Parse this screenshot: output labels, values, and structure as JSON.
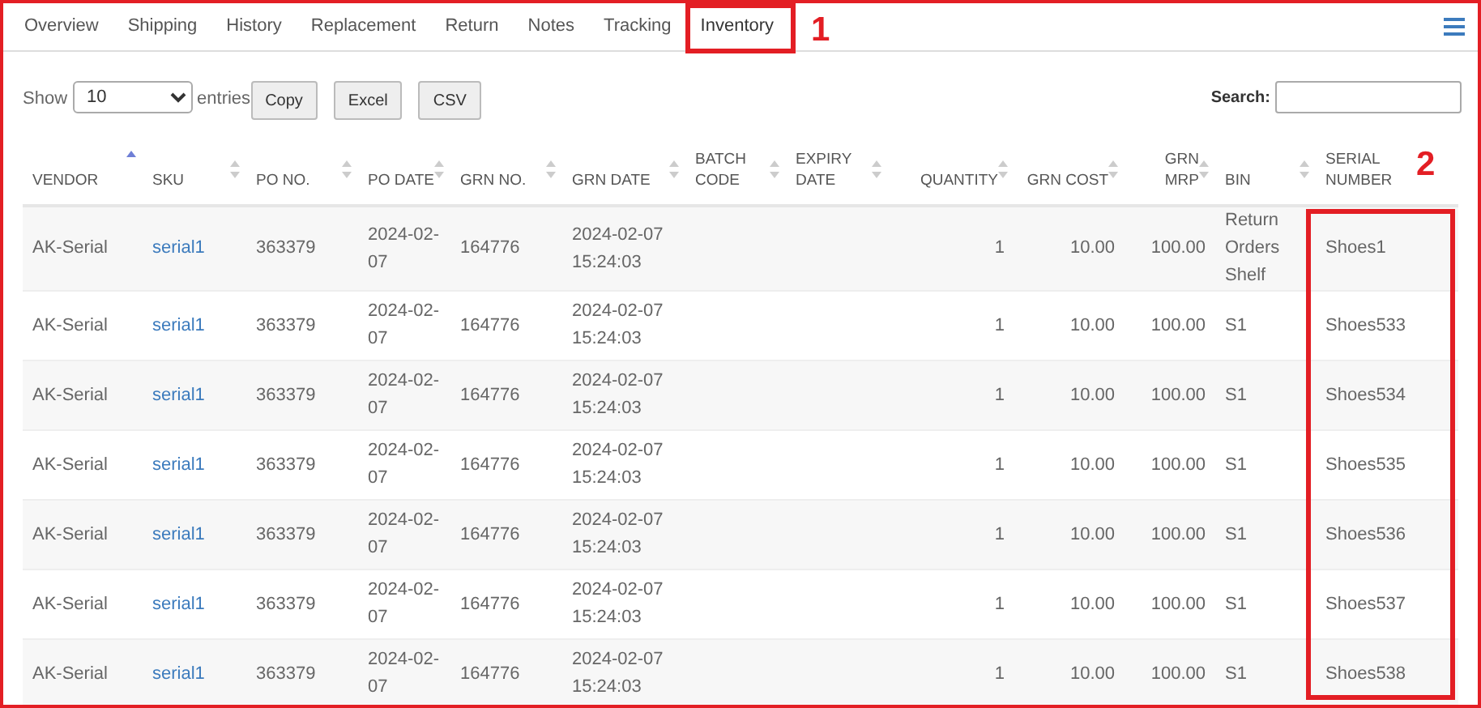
{
  "tabs": [
    {
      "label": "Overview",
      "selected": false
    },
    {
      "label": "Shipping",
      "selected": false
    },
    {
      "label": "History",
      "selected": false
    },
    {
      "label": "Replacement",
      "selected": false
    },
    {
      "label": "Return",
      "selected": false
    },
    {
      "label": "Notes",
      "selected": false
    },
    {
      "label": "Tracking",
      "selected": false
    },
    {
      "label": "Inventory",
      "selected": true,
      "annotation": "1"
    }
  ],
  "toolbar": {
    "show_label": "Show",
    "page_size": "10",
    "entries_label": "entries",
    "buttons": [
      "Copy",
      "Excel",
      "CSV"
    ],
    "search_label": "Search:"
  },
  "table": {
    "columns": [
      {
        "label": "VENDOR",
        "sorted": true
      },
      {
        "label": "SKU",
        "sorted": false
      },
      {
        "label": "PO NO.",
        "sorted": false
      },
      {
        "label": "PO DATE",
        "sorted": false
      },
      {
        "label": "GRN NO.",
        "sorted": false
      },
      {
        "label": "GRN DATE",
        "sorted": false
      },
      {
        "label": "BATCH CODE",
        "sorted": false
      },
      {
        "label": "EXPIRY DATE",
        "sorted": false
      },
      {
        "label": "QUANTITY",
        "sorted": false
      },
      {
        "label": "GRN COST",
        "sorted": false
      },
      {
        "label": "GRN MRP",
        "sorted": false
      },
      {
        "label": "BIN",
        "sorted": false
      },
      {
        "label": "SERIAL NUMBER",
        "annotation": "2"
      }
    ],
    "rows": [
      [
        "AK-Serial",
        "serial1",
        "363379",
        "2024-02-07",
        "164776",
        "2024-02-07 15:24:03",
        null,
        null,
        "1",
        "10.00",
        "100.00",
        "Return Orders Shelf",
        "Shoes1"
      ],
      [
        "AK-Serial",
        "serial1",
        "363379",
        "2024-02-07",
        "164776",
        "2024-02-07 15:24:03",
        null,
        null,
        "1",
        "10.00",
        "100.00",
        "S1",
        "Shoes533"
      ],
      [
        "AK-Serial",
        "serial1",
        "363379",
        "2024-02-07",
        "164776",
        "2024-02-07 15:24:03",
        null,
        null,
        "1",
        "10.00",
        "100.00",
        "S1",
        "Shoes534"
      ],
      [
        "AK-Serial",
        "serial1",
        "363379",
        "2024-02-07",
        "164776",
        "2024-02-07 15:24:03",
        null,
        null,
        "1",
        "10.00",
        "100.00",
        "S1",
        "Shoes535"
      ],
      [
        "AK-Serial",
        "serial1",
        "363379",
        "2024-02-07",
        "164776",
        "2024-02-07 15:24:03",
        null,
        null,
        "1",
        "10.00",
        "100.00",
        "S1",
        "Shoes536"
      ],
      [
        "AK-Serial",
        "serial1",
        "363379",
        "2024-02-07",
        "164776",
        "2024-02-07 15:24:03",
        null,
        null,
        "1",
        "10.00",
        "100.00",
        "S1",
        "Shoes537"
      ],
      [
        "AK-Serial",
        "serial1",
        "363379",
        "2024-02-07",
        "164776",
        "2024-02-07 15:24:03",
        null,
        null,
        "1",
        "10.00",
        "100.00",
        "S1",
        "Shoes538"
      ]
    ]
  }
}
